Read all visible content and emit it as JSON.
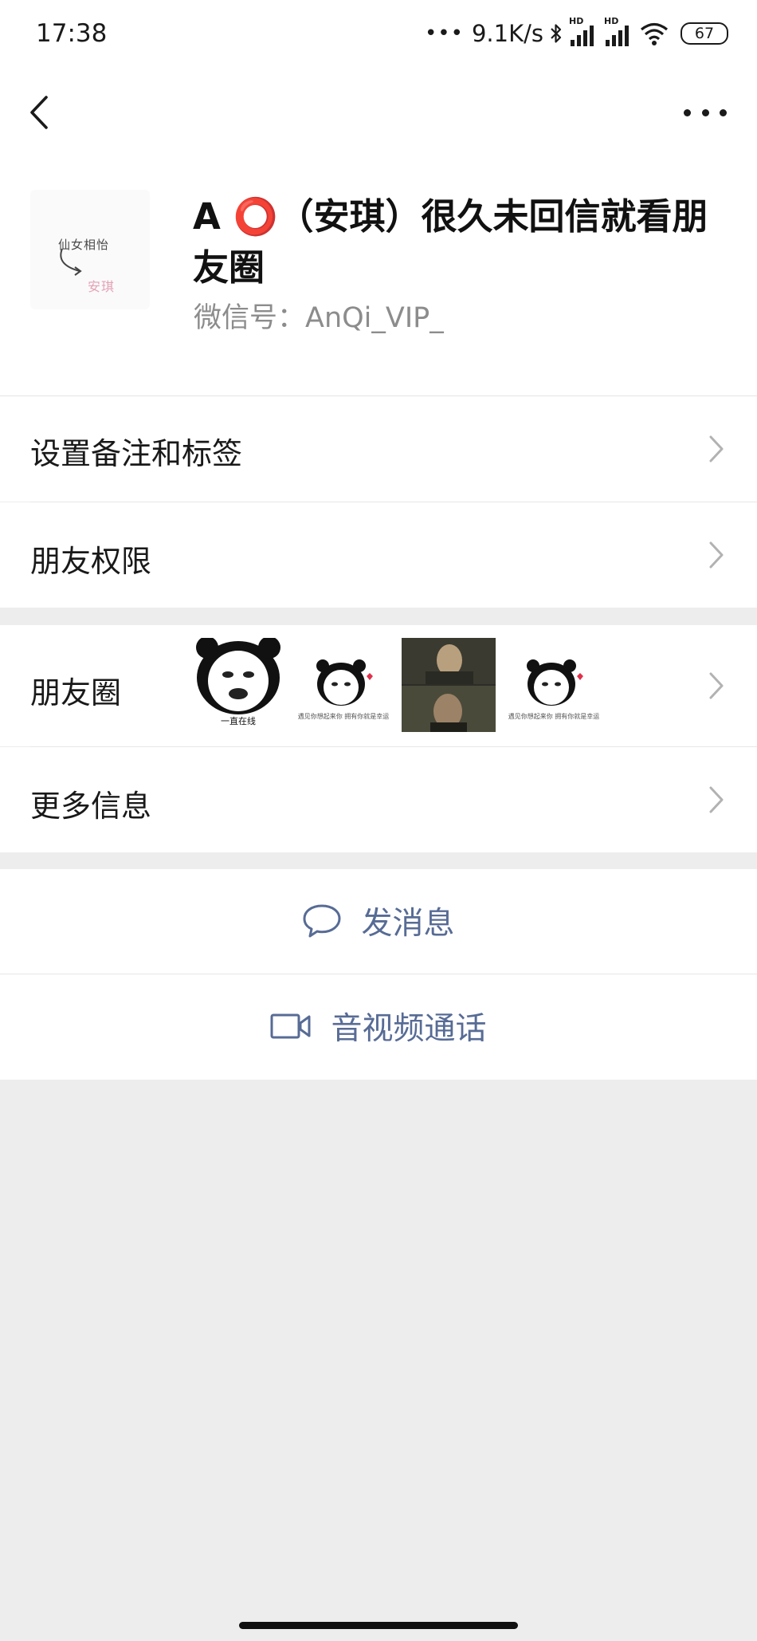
{
  "status_bar": {
    "time": "17:38",
    "dots": "•••",
    "network_speed": "9.1K/s",
    "signal_1_label": "HD",
    "signal_2_label": "HD",
    "battery_level": "67",
    "icons": [
      "bluetooth-icon",
      "signal-icon",
      "signal-icon",
      "wifi-icon",
      "battery-icon"
    ]
  },
  "nav": {
    "back_icon": "chevron-left-icon",
    "more_icon": "more-dots-icon"
  },
  "profile": {
    "name": "A ⭕️（安琪）很久未回信就看朋友圈",
    "wechat_id": "微信号：AnQi_VIP_",
    "avatar_text_top": "仙女相怡",
    "avatar_text_bottom": "安琪"
  },
  "rows": {
    "remarks_label": "设置备注和标签",
    "permissions_label": "朋友权限",
    "moments_label": "朋友圈",
    "more_info_label": "更多信息"
  },
  "moments_thumbs": [
    {
      "caption": "一直在线"
    },
    {
      "caption": "遇见你想起来你 拥有你就是幸运"
    },
    {
      "caption": ""
    },
    {
      "caption": "遇见你想起来你 拥有你就是幸运"
    }
  ],
  "actions": {
    "message_label": "发消息",
    "call_label": "音视频通话"
  },
  "colors": {
    "link_blue": "#576b95",
    "page_bg": "#ededed",
    "row_bg": "#ffffff",
    "chevron_gray": "#b2b2b2"
  }
}
